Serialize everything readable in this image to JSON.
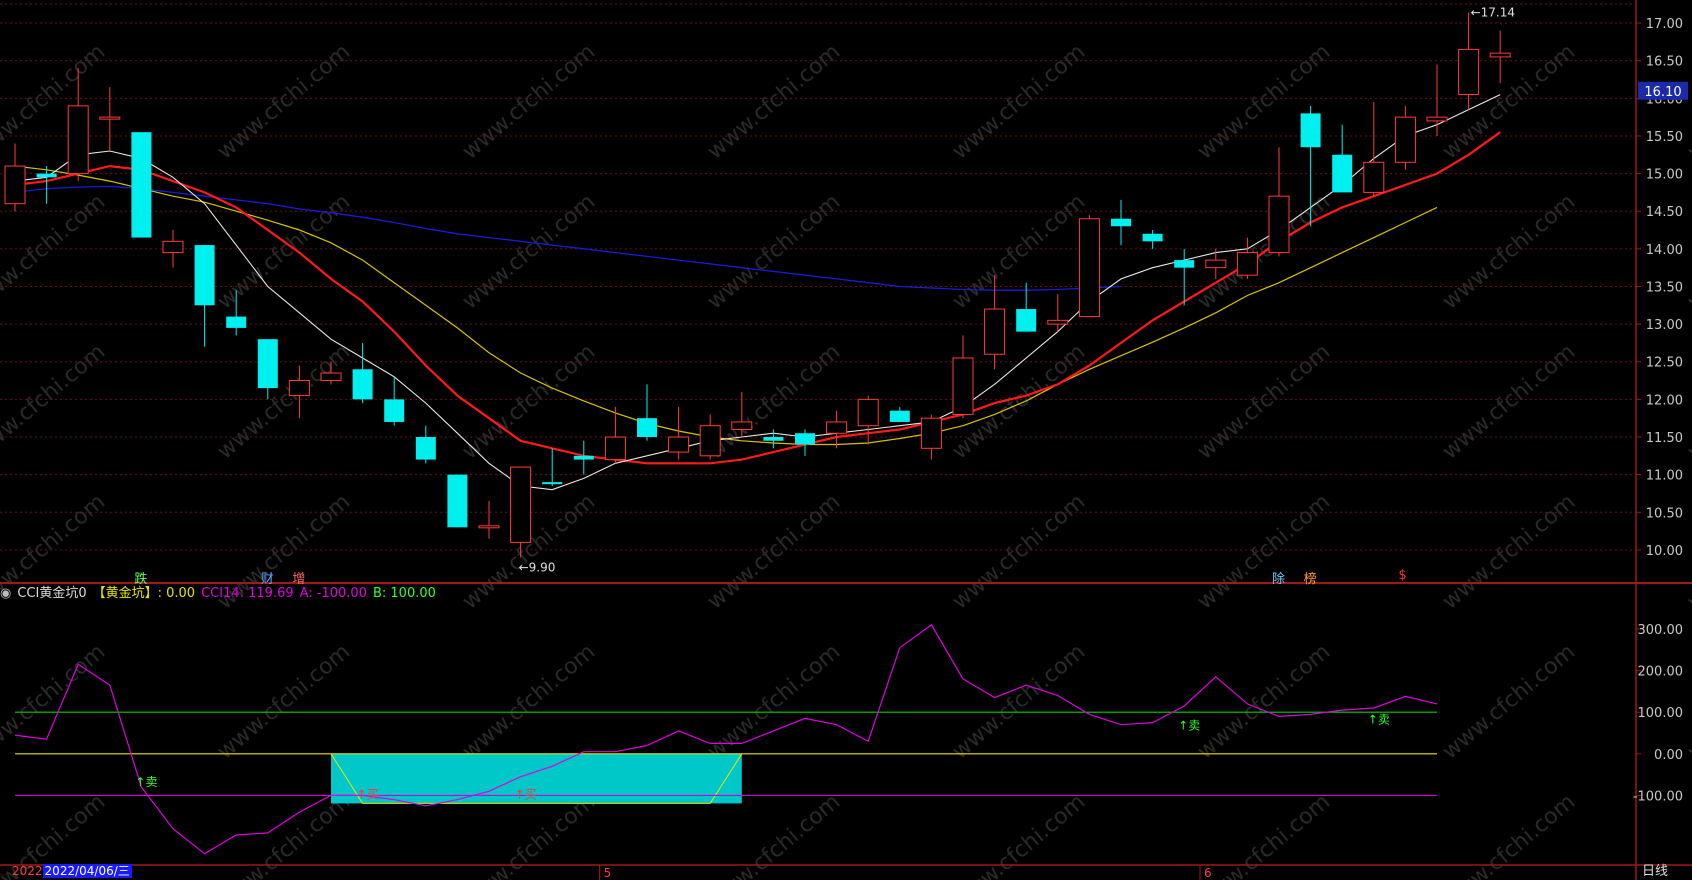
{
  "colors": {
    "bg": "#000000",
    "grid": "#6e1010",
    "up": "#ff3b3b",
    "down": "#00f0f0",
    "ma_white": "#e8e8e8",
    "ma_red": "#ff1a1a",
    "ma_yellow": "#d6c200",
    "ma_blue": "#1b1bd6",
    "axis_text": "#c8c8c8",
    "cci_line": "#e000e0",
    "line_b": "#00d000",
    "line_zero": "#e6e600",
    "line_a": "#d000d0",
    "pit_fill": "#00c8c8"
  },
  "header": {
    "indicator_name": "CCI黄金坑0",
    "pit_label": "【黄金坑】: 0.00",
    "cci_label": "CCI14: 119.69",
    "a_label": "A: -100.00",
    "b_label": "B: 100.00"
  },
  "event_tags": [
    {
      "text": "跌",
      "color": "#66ff66",
      "x_index": 4
    },
    {
      "text": "财",
      "color": "#66aaff",
      "x_index": 8
    },
    {
      "text": "增",
      "color": "#ff6666",
      "x_index": 9
    },
    {
      "text": "除",
      "color": "#66ccff",
      "x_index": 40
    },
    {
      "text": "榜",
      "color": "#ff9933",
      "x_index": 41
    },
    {
      "text": "$",
      "color": "#ff3333",
      "x_index": 44
    }
  ],
  "footer": {
    "date_prefix": "2022",
    "date_highlight": "2022/04/06/三",
    "month_labels": [
      {
        "text": "5",
        "x_index": 19
      },
      {
        "text": "6",
        "x_index": 38
      }
    ],
    "period": "日线"
  },
  "watermark": "www.cfchi.com",
  "chart_data": [
    {
      "type": "candlestick",
      "price_axis_ticks": [
        "17.00",
        "16.50",
        "16.00",
        "15.50",
        "15.00",
        "14.50",
        "14.00",
        "13.50",
        "13.00",
        "12.50",
        "12.00",
        "11.50",
        "11.00",
        "10.50",
        "10.00"
      ],
      "ylim": [
        9.6,
        17.2
      ],
      "current_price": "16.10",
      "high_label": "17.14",
      "low_label": "9.90",
      "candles": [
        {
          "o": 14.6,
          "h": 15.4,
          "l": 14.5,
          "c": 15.1
        },
        {
          "o": 15.0,
          "h": 15.1,
          "l": 14.6,
          "c": 14.95
        },
        {
          "o": 15.0,
          "h": 16.4,
          "l": 14.9,
          "c": 15.9
        },
        {
          "o": 15.75,
          "h": 16.15,
          "l": 15.3,
          "c": 15.75
        },
        {
          "o": 15.55,
          "h": 15.55,
          "l": 14.15,
          "c": 14.15
        },
        {
          "o": 13.95,
          "h": 14.25,
          "l": 13.75,
          "c": 14.1
        },
        {
          "o": 14.05,
          "h": 14.05,
          "l": 12.7,
          "c": 13.25
        },
        {
          "o": 13.1,
          "h": 13.45,
          "l": 12.85,
          "c": 12.95
        },
        {
          "o": 12.8,
          "h": 12.8,
          "l": 12.0,
          "c": 12.15
        },
        {
          "o": 12.05,
          "h": 12.45,
          "l": 11.75,
          "c": 12.25
        },
        {
          "o": 12.25,
          "h": 12.5,
          "l": 12.2,
          "c": 12.35
        },
        {
          "o": 12.4,
          "h": 12.75,
          "l": 11.95,
          "c": 12.0
        },
        {
          "o": 12.0,
          "h": 12.3,
          "l": 11.65,
          "c": 11.7
        },
        {
          "o": 11.5,
          "h": 11.65,
          "l": 11.15,
          "c": 11.2
        },
        {
          "o": 11.0,
          "h": 11.0,
          "l": 10.3,
          "c": 10.3
        },
        {
          "o": 10.3,
          "h": 10.65,
          "l": 10.15,
          "c": 10.32
        },
        {
          "o": 10.1,
          "h": 11.1,
          "l": 9.9,
          "c": 11.1
        },
        {
          "o": 10.9,
          "h": 11.35,
          "l": 10.85,
          "c": 10.88
        },
        {
          "o": 11.25,
          "h": 11.45,
          "l": 11.0,
          "c": 11.2
        },
        {
          "o": 11.2,
          "h": 11.9,
          "l": 11.15,
          "c": 11.5
        },
        {
          "o": 11.75,
          "h": 12.2,
          "l": 11.45,
          "c": 11.5
        },
        {
          "o": 11.3,
          "h": 11.9,
          "l": 11.2,
          "c": 11.5
        },
        {
          "o": 11.25,
          "h": 11.8,
          "l": 11.2,
          "c": 11.65
        },
        {
          "o": 11.6,
          "h": 12.1,
          "l": 11.5,
          "c": 11.7
        },
        {
          "o": 11.5,
          "h": 11.6,
          "l": 11.35,
          "c": 11.45
        },
        {
          "o": 11.55,
          "h": 11.6,
          "l": 11.25,
          "c": 11.4
        },
        {
          "o": 11.55,
          "h": 11.85,
          "l": 11.35,
          "c": 11.7
        },
        {
          "o": 11.65,
          "h": 12.05,
          "l": 11.4,
          "c": 12.0
        },
        {
          "o": 11.85,
          "h": 11.9,
          "l": 11.7,
          "c": 11.7
        },
        {
          "o": 11.35,
          "h": 11.8,
          "l": 11.2,
          "c": 11.75
        },
        {
          "o": 11.8,
          "h": 12.85,
          "l": 11.75,
          "c": 12.55
        },
        {
          "o": 12.6,
          "h": 13.65,
          "l": 12.4,
          "c": 13.2
        },
        {
          "o": 13.2,
          "h": 13.55,
          "l": 12.9,
          "c": 12.9
        },
        {
          "o": 13.0,
          "h": 13.4,
          "l": 12.9,
          "c": 13.05
        },
        {
          "o": 13.1,
          "h": 14.45,
          "l": 13.1,
          "c": 14.4
        },
        {
          "o": 14.4,
          "h": 14.65,
          "l": 14.05,
          "c": 14.3
        },
        {
          "o": 14.2,
          "h": 14.25,
          "l": 14.0,
          "c": 14.1
        },
        {
          "o": 13.85,
          "h": 14.0,
          "l": 13.25,
          "c": 13.75
        },
        {
          "o": 13.75,
          "h": 14.0,
          "l": 13.6,
          "c": 13.85
        },
        {
          "o": 13.65,
          "h": 14.15,
          "l": 13.6,
          "c": 13.95
        },
        {
          "o": 13.95,
          "h": 15.35,
          "l": 13.9,
          "c": 14.7
        },
        {
          "o": 15.8,
          "h": 15.9,
          "l": 14.3,
          "c": 15.35
        },
        {
          "o": 15.25,
          "h": 15.65,
          "l": 14.8,
          "c": 14.75
        },
        {
          "o": 14.75,
          "h": 15.95,
          "l": 14.7,
          "c": 15.15
        },
        {
          "o": 15.15,
          "h": 15.9,
          "l": 15.05,
          "c": 15.75
        },
        {
          "o": 15.7,
          "h": 16.45,
          "l": 15.5,
          "c": 15.75
        },
        {
          "o": 16.05,
          "h": 17.14,
          "l": 15.85,
          "c": 16.65
        },
        {
          "o": 16.55,
          "h": 16.9,
          "l": 16.2,
          "c": 16.6
        }
      ],
      "ma_white": [
        14.9,
        14.95,
        15.25,
        15.3,
        15.2,
        14.95,
        14.6,
        14.05,
        13.5,
        13.15,
        12.8,
        12.55,
        12.3,
        11.95,
        11.55,
        11.15,
        10.85,
        10.8,
        10.95,
        11.15,
        11.25,
        11.35,
        11.45,
        11.5,
        11.55,
        11.5,
        11.55,
        11.6,
        11.65,
        11.7,
        11.9,
        12.2,
        12.55,
        12.9,
        13.3,
        13.6,
        13.75,
        13.85,
        13.95,
        14.0,
        14.25,
        14.55,
        14.85,
        15.2,
        15.5,
        15.65,
        15.85,
        16.05
      ],
      "ma_red": [
        14.85,
        14.9,
        15.0,
        15.1,
        15.05,
        14.9,
        14.75,
        14.55,
        14.25,
        13.95,
        13.6,
        13.3,
        12.9,
        12.45,
        12.05,
        11.75,
        11.45,
        11.35,
        11.25,
        11.2,
        11.15,
        11.15,
        11.15,
        11.2,
        11.3,
        11.4,
        11.5,
        11.55,
        11.6,
        11.7,
        11.8,
        11.95,
        12.05,
        12.2,
        12.45,
        12.75,
        13.05,
        13.3,
        13.55,
        13.8,
        14.1,
        14.35,
        14.55,
        14.7,
        14.85,
        15.0,
        15.25,
        15.55
      ],
      "ma_yellow": [
        15.1,
        15.05,
        14.98,
        14.9,
        14.8,
        14.7,
        14.62,
        14.5,
        14.38,
        14.25,
        14.08,
        13.85,
        13.55,
        13.25,
        12.95,
        12.62,
        12.35,
        12.15,
        11.98,
        11.82,
        11.68,
        11.58,
        11.5,
        11.45,
        11.42,
        11.4,
        11.4,
        11.42,
        11.48,
        11.55,
        11.65,
        11.8,
        11.98,
        12.2,
        12.4,
        12.58,
        12.76,
        12.95,
        13.15,
        13.38,
        13.55,
        13.75,
        13.95,
        14.15,
        14.35,
        14.55
      ],
      "ma_blue": [
        14.75,
        14.8,
        14.82,
        14.83,
        14.8,
        14.75,
        14.7,
        14.65,
        14.6,
        14.53,
        14.48,
        14.42,
        14.35,
        14.27,
        14.2,
        14.15,
        14.1,
        14.05,
        14.0,
        13.95,
        13.9,
        13.85,
        13.8,
        13.75,
        13.7,
        13.65,
        13.6,
        13.55,
        13.5,
        13.48,
        13.46,
        13.45,
        13.45,
        13.46,
        13.48,
        13.5
      ]
    },
    {
      "type": "line",
      "name": "CCI14",
      "y_axis_ticks": [
        "300.00",
        "200.00",
        "100.00",
        "0.00",
        "-100.00"
      ],
      "ylim": [
        -260,
        360
      ],
      "values": [
        45,
        35,
        215,
        165,
        -80,
        -180,
        -240,
        -195,
        -190,
        -140,
        -100,
        -100,
        -110,
        -125,
        -110,
        -90,
        -55,
        -30,
        5,
        5,
        20,
        55,
        25,
        25,
        55,
        85,
        70,
        30,
        255,
        310,
        180,
        135,
        165,
        140,
        95,
        70,
        75,
        115,
        185,
        120,
        90,
        95,
        105,
        110,
        138,
        120
      ],
      "lines": {
        "B": 100,
        "zero": 0,
        "A": -100
      },
      "pit_range": [
        10,
        23
      ],
      "signals": [
        {
          "text": "卖",
          "index": 4,
          "value": -65,
          "color": "#33ff33"
        },
        {
          "text": "买",
          "index": 11,
          "value": -95,
          "color": "#ff3333"
        },
        {
          "text": "买",
          "index": 16,
          "value": -95,
          "color": "#ff3333"
        },
        {
          "text": "卖",
          "index": 37,
          "value": 70,
          "color": "#33ff33"
        },
        {
          "text": "卖",
          "index": 43,
          "value": 85,
          "color": "#33ff33"
        }
      ]
    }
  ]
}
